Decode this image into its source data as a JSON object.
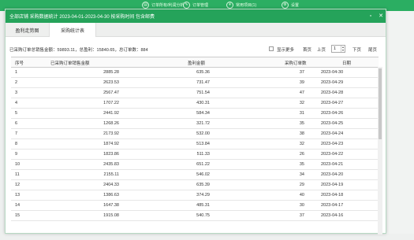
{
  "background_nav": [
    {
      "icon": "chart-icon",
      "label": "订单所有/利润分析"
    },
    {
      "icon": "pencil-icon",
      "label": "订单管理"
    },
    {
      "icon": "money-icon",
      "label": "常用项目(1)"
    },
    {
      "icon": "gear-icon",
      "label": "设置"
    }
  ],
  "dialog": {
    "title": "全部店铺 采购数据统计 2023-04-01-2023-04-30 按采购时间 包含邮费",
    "tabs": [
      "盈利走势图",
      "采购统计表"
    ],
    "active_tab": 1
  },
  "summary": {
    "text": "已采购订单总销售金额：59893.11，总盈利：15840.65，总订单数：884",
    "show_more_label": "显示更多",
    "first_page_label": "首页",
    "prev_page_label": "上页",
    "page_value": "1",
    "next_page_label": "下页",
    "last_page_label": "尾页"
  },
  "table": {
    "headers": [
      "序号",
      "已采购订单销售金额",
      "盈利金额",
      "采购订单数",
      "日期"
    ],
    "rows": [
      [
        "1",
        "2885.28",
        "635.36",
        "37",
        "2023-04-30"
      ],
      [
        "2",
        "2623.53",
        "731.47",
        "39",
        "2023-04-29"
      ],
      [
        "3",
        "2567.47",
        "751.54",
        "47",
        "2023-04-28"
      ],
      [
        "4",
        "1707.22",
        "430.31",
        "32",
        "2023-04-27"
      ],
      [
        "5",
        "2441.92",
        "584.34",
        "31",
        "2023-04-26"
      ],
      [
        "6",
        "1268.26",
        "321.72",
        "35",
        "2023-04-25"
      ],
      [
        "7",
        "2173.92",
        "532.00",
        "38",
        "2023-04-24"
      ],
      [
        "8",
        "1874.92",
        "513.84",
        "32",
        "2023-04-23"
      ],
      [
        "9",
        "1823.86",
        "511.33",
        "26",
        "2023-04-22"
      ],
      [
        "10",
        "2435.83",
        "651.22",
        "35",
        "2023-04-21"
      ],
      [
        "11",
        "2155.11",
        "546.02",
        "34",
        "2023-04-20"
      ],
      [
        "12",
        "2404.33",
        "635.39",
        "29",
        "2023-04-19"
      ],
      [
        "13",
        "1386.63",
        "374.29",
        "40",
        "2023-04-18"
      ],
      [
        "14",
        "1647.38",
        "485.31",
        "30",
        "2023-04-17"
      ],
      [
        "15",
        "1915.08",
        "540.75",
        "37",
        "2023-04-16"
      ]
    ]
  }
}
